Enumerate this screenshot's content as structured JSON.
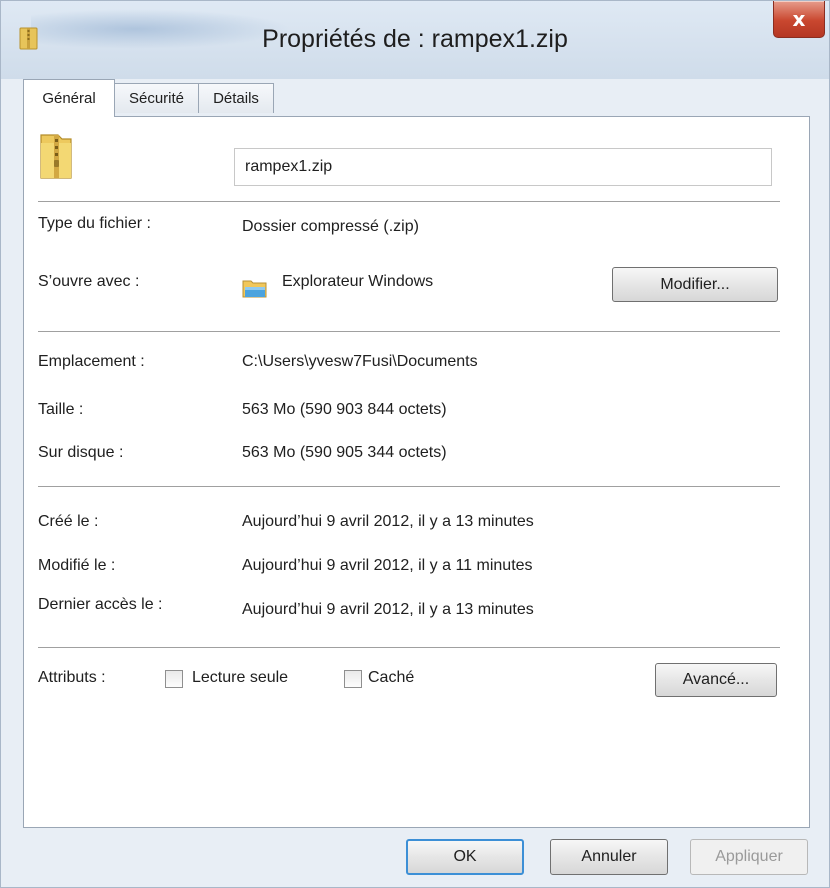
{
  "window": {
    "title": "Propriétés de : rampex1.zip",
    "close_symbol": "x",
    "accent_close": "#c9472f"
  },
  "tabs": [
    {
      "label": "Général",
      "active": true
    },
    {
      "label": "Sécurité",
      "active": false
    },
    {
      "label": "Détails",
      "active": false
    }
  ],
  "general": {
    "file_icon": "zip-folder-icon",
    "file_name": "rampex1.zip",
    "file_type_label": "Type du fichier :",
    "file_type_value": "Dossier compressé (.zip)",
    "opens_with_label": "S’ouvre avec :",
    "opens_with_app": "Explorateur Windows",
    "opens_with_icon": "explorer-folder-icon",
    "change_button": "Modifier...",
    "location_label": "Emplacement :",
    "location_value": "C:\\Users\\yvesw7Fusi\\Documents",
    "size_label": "Taille :",
    "size_value": "563 Mo (590 903 844 octets)",
    "disk_size_label": "Sur disque :",
    "disk_size_value": "563 Mo (590 905 344 octets)",
    "created_label": "Créé le :",
    "created_value": "Aujourd’hui 9 avril 2012, il y a 13 minutes",
    "modified_label": "Modifié le :",
    "modified_value": "Aujourd’hui 9 avril 2012, il y a 11 minutes",
    "accessed_label": "Dernier accès le :",
    "accessed_value": "Aujourd’hui 9 avril 2012, il y a 13 minutes",
    "attributes_label": "Attributs :",
    "readonly_label": "Lecture seule",
    "readonly_checked": false,
    "hidden_label": "Caché",
    "hidden_checked": false,
    "advanced_button": "Avancé..."
  },
  "footer": {
    "ok": "OK",
    "cancel": "Annuler",
    "apply": "Appliquer"
  }
}
